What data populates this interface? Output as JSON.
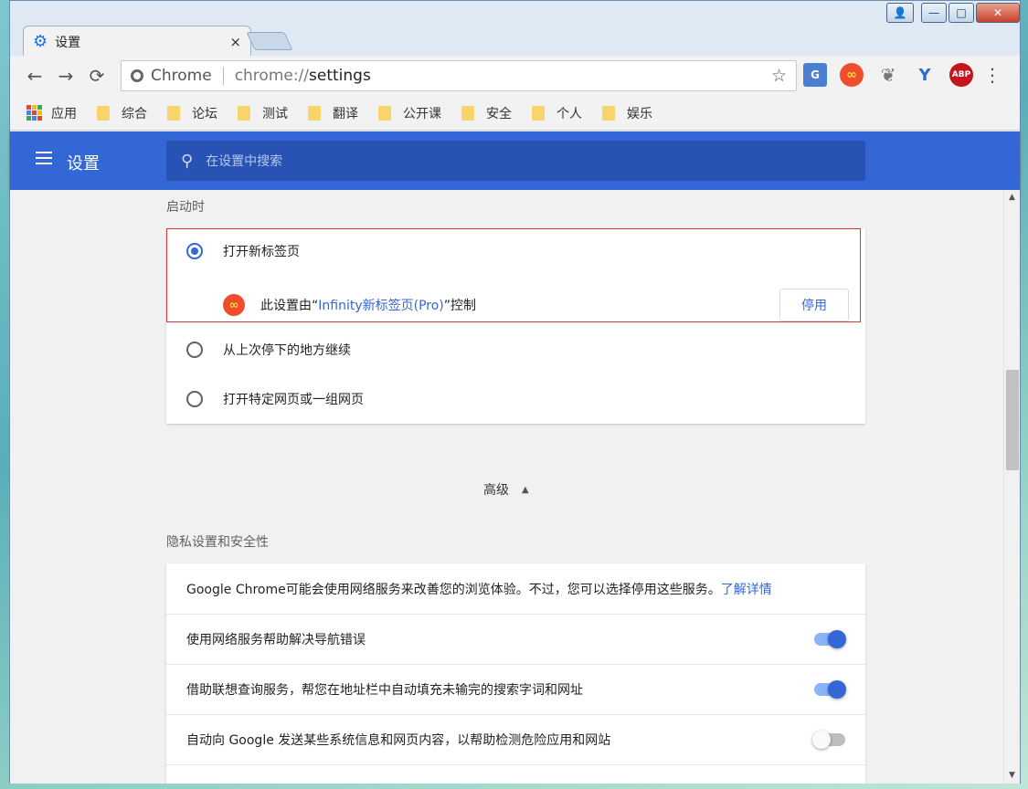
{
  "window": {
    "tab_title": "设置",
    "tab_close": "×",
    "controls": {
      "minimize": "—",
      "maximize": "□",
      "close": "✕"
    }
  },
  "toolbar": {
    "site_name": "Chrome",
    "url_scheme": "chrome://",
    "url_path": "settings",
    "back": "←",
    "forward": "→",
    "reload": "⟳",
    "star": "☆"
  },
  "extensions": {
    "translate": "G",
    "infinity": "∞",
    "leaf": "❦",
    "y": "Y",
    "abp": "ABP",
    "menu": "⋮"
  },
  "bookmarks": {
    "apps": "应用",
    "folders": [
      "综合",
      "论坛",
      "测试",
      "翻译",
      "公开课",
      "安全",
      "个人",
      "娱乐"
    ]
  },
  "header": {
    "title": "设置",
    "search_placeholder": "在设置中搜索"
  },
  "startup": {
    "section_title": "启动时",
    "options": [
      {
        "label": "打开新标签页",
        "checked": true
      },
      {
        "label": "从上次停下的地方继续",
        "checked": false
      },
      {
        "label": "打开特定网页或一组网页",
        "checked": false
      }
    ],
    "controlled": {
      "prefix": "此设置由“",
      "extension_name": "Infinity新标签页(Pro)",
      "suffix": "”控制",
      "disable_label": "停用",
      "icon": "∞"
    }
  },
  "advanced": {
    "label": "高级",
    "arrow": "▲"
  },
  "privacy": {
    "section_title": "隐私设置和安全性",
    "intro": "Google Chrome可能会使用网络服务来改善您的浏览体验。不过，您可以选择停用这些服务。",
    "learn_more": "了解详情",
    "toggles": [
      {
        "label": "使用网络服务帮助解决导航错误",
        "on": true
      },
      {
        "label": "借助联想查询服务，帮您在地址栏中自动填充未输完的搜索字词和网址",
        "on": true
      },
      {
        "label": "自动向 Google 发送某些系统信息和网页内容，以帮助检测危险应用和网站",
        "on": false
      }
    ]
  },
  "colors": {
    "accent": "#3367d6",
    "header_bg": "#3367d6",
    "highlight_border": "#d9363e"
  }
}
